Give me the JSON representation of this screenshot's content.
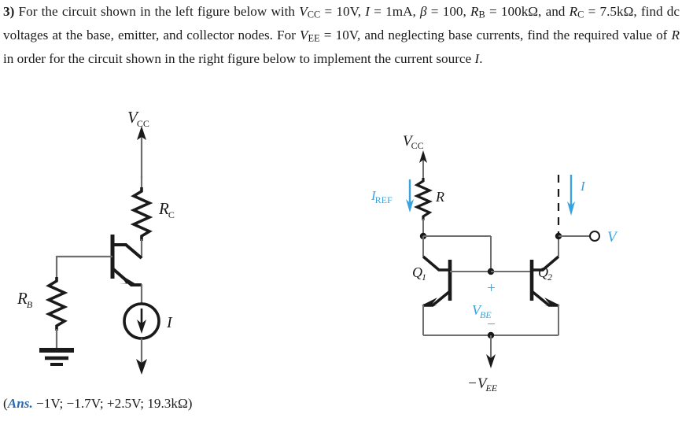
{
  "problem": {
    "number": "3)",
    "line1_a": "For the circuit shown in the left figure below with ",
    "v_cc": "V",
    "v_cc_sub": "CC",
    "eq1": " = 10V, ",
    "i_sym": "I",
    "eq2": " = 1mA, ",
    "beta_sym": "β",
    "eq3": " = 100, ",
    "r_b": "R",
    "r_b_sub": "B",
    "eq4": " = 100kΩ, and ",
    "r_c": "R",
    "r_c_sub": "C",
    "eq5": " = 7.5kΩ, find dc voltages at the base, emitter, and collector nodes. For ",
    "v_ee": "V",
    "v_ee_sub": "EE",
    "eq6": " = 10V, and neglecting base currents, find the required value of ",
    "r_sym": "R",
    "eq7": " in order for the circuit shown in the right figure below to implement the current source ",
    "i_sym2": "I",
    "eq8": "."
  },
  "answer": {
    "open_paren": "(",
    "label": "Ans.",
    "values": " −1V; −1.7V; +2.5V; 19.3kΩ)"
  },
  "figure_left": {
    "title": "common-emitter-bias-circuit",
    "vcc_label": "V",
    "vcc_sub": "CC",
    "rc_label": "R",
    "rc_sub": "C",
    "rb_label": "R",
    "rb_sub": "B",
    "current_label": "I",
    "ground": "ground-symbol",
    "transistor": "npn-transistor"
  },
  "figure_right": {
    "title": "current-mirror-circuit",
    "vcc_label": "V",
    "vcc_sub": "CC",
    "iref_label": "I",
    "iref_sub": "REF",
    "r_label": "R",
    "i_label": "I",
    "v_label": "V",
    "q1_label": "Q",
    "q1_sub": "1",
    "q2_label": "Q",
    "q2_sub": "2",
    "vbe_label": "V",
    "vbe_sub": "BE",
    "plus_sign": "+",
    "minus_sign": "−",
    "vee_label": "−V",
    "vee_sub": "EE"
  },
  "colors": {
    "accent_blue": "#3aa3dd",
    "ans_blue": "#2b6cb0",
    "wire": "#6e6e6e",
    "ink": "#1a1a1a"
  }
}
